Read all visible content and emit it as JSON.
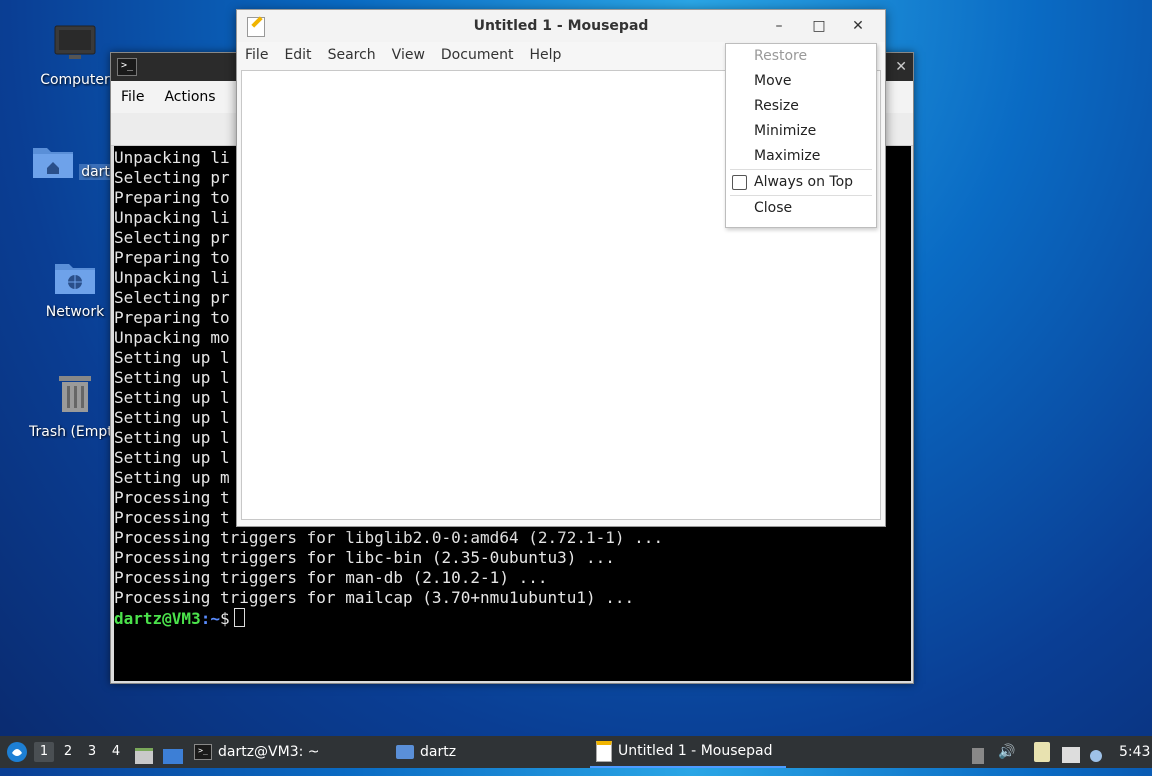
{
  "desktop": {
    "icons": [
      {
        "label": "Computer"
      },
      {
        "label": "dartz"
      },
      {
        "label": "Network"
      },
      {
        "label": "Trash (Empty)"
      }
    ]
  },
  "terminal": {
    "menu": [
      "File",
      "Actions"
    ],
    "lines": [
      "Unpacking li",
      "Selecting pr",
      "Preparing to",
      "Unpacking li",
      "Selecting pr",
      "Preparing to",
      "Unpacking li",
      "Selecting pr",
      "Preparing to",
      "Unpacking mo",
      "Setting up l",
      "Setting up l",
      "Setting up l",
      "Setting up l",
      "Setting up l",
      "Setting up l",
      "Setting up m",
      "Processing t",
      "Processing t",
      "Processing triggers for libglib2.0-0:amd64 (2.72.1-1) ...",
      "Processing triggers for libc-bin (2.35-0ubuntu3) ...",
      "Processing triggers for man-db (2.10.2-1) ...",
      "Processing triggers for mailcap (3.70+nmu1ubuntu1) ..."
    ],
    "prompt_user": "dartz@VM3",
    "prompt_path": ":~",
    "prompt_symbol": "$"
  },
  "mousepad": {
    "title": "Untitled 1 - Mousepad",
    "menu": [
      "File",
      "Edit",
      "Search",
      "View",
      "Document",
      "Help"
    ],
    "minimize_glyph": "–",
    "maximize_glyph": "□",
    "close_glyph": "✕"
  },
  "context_menu": {
    "restore": "Restore",
    "move": "Move",
    "resize": "Resize",
    "minimize": "Minimize",
    "maximize": "Maximize",
    "always_on_top": "Always on Top",
    "close": "Close"
  },
  "taskbar": {
    "workspaces": [
      "1",
      "2",
      "3",
      "4"
    ],
    "tasks": {
      "terminal": "dartz@VM3: ~",
      "files": "dartz",
      "mousepad": "Untitled 1 - Mousepad"
    },
    "clock": "5:43"
  },
  "colors": {
    "accent": "#4d9bff",
    "prompt_user": "#4be24b",
    "prompt_path": "#5a8cff"
  }
}
